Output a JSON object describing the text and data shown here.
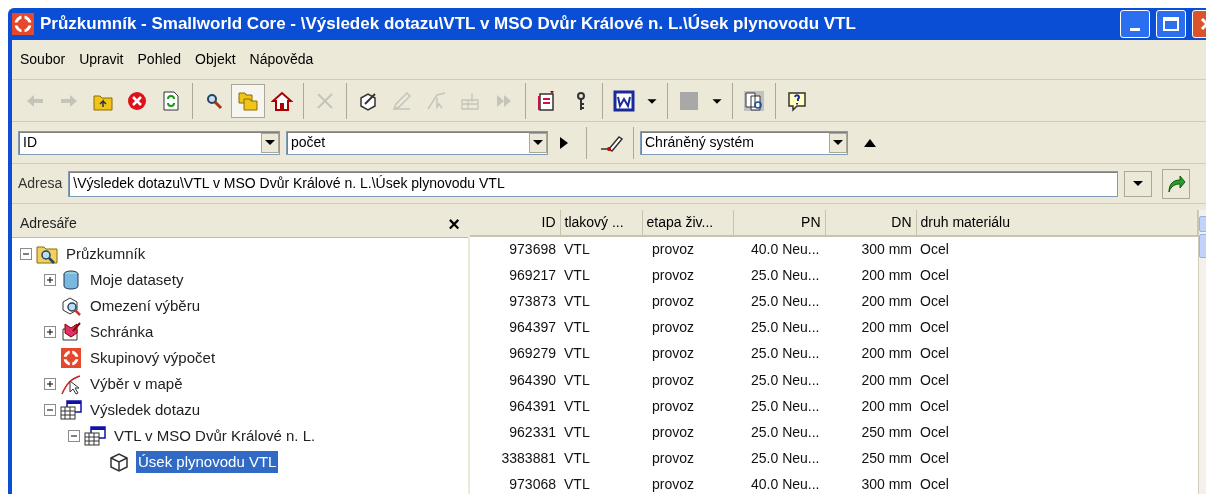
{
  "window": {
    "title": "Průzkumník - Smallworld Core - \\Výsledek dotazu\\VTL v MSO Dvůr Králové n. L.\\Úsek plynovodu VTL"
  },
  "menu": [
    {
      "label": "Soubor"
    },
    {
      "label": "Upravit"
    },
    {
      "label": "Pohled"
    },
    {
      "label": "Objekt"
    },
    {
      "label": "Nápověda"
    }
  ],
  "toolbar": [
    {
      "kind": "back",
      "disabled": true
    },
    {
      "kind": "forward",
      "disabled": true
    },
    {
      "kind": "up-folder",
      "disabled": false
    },
    {
      "kind": "stop",
      "disabled": false
    },
    {
      "kind": "refresh",
      "disabled": false
    },
    {
      "kind": "separator"
    },
    {
      "kind": "search",
      "disabled": false
    },
    {
      "kind": "folders",
      "disabled": false,
      "selected": true
    },
    {
      "kind": "home",
      "disabled": false
    },
    {
      "kind": "separator"
    },
    {
      "kind": "delete",
      "disabled": true
    },
    {
      "kind": "separator"
    },
    {
      "kind": "tool",
      "disabled": false
    },
    {
      "kind": "pencil",
      "disabled": true
    },
    {
      "kind": "pointer",
      "disabled": true
    },
    {
      "kind": "edit",
      "disabled": true
    },
    {
      "kind": "fast-forward",
      "disabled": true
    },
    {
      "kind": "separator"
    },
    {
      "kind": "report",
      "disabled": false
    },
    {
      "kind": "key",
      "disabled": false
    },
    {
      "kind": "separator"
    },
    {
      "kind": "word",
      "disabled": false
    },
    {
      "kind": "dropdown",
      "disabled": false
    },
    {
      "kind": "separator"
    },
    {
      "kind": "pattern",
      "disabled": false
    },
    {
      "kind": "dropdown",
      "disabled": false
    },
    {
      "kind": "separator"
    },
    {
      "kind": "preview",
      "disabled": false
    },
    {
      "kind": "separator"
    },
    {
      "kind": "help",
      "disabled": false
    }
  ],
  "filter": {
    "field": "ID",
    "function": "počet",
    "system": "Chráněný systém"
  },
  "address": {
    "label": "Adresa",
    "value": "\\Výsledek dotazu\\VTL v MSO Dvůr Králové n. L.\\Úsek plynovodu VTL"
  },
  "sidebar": {
    "title": "Adresáře",
    "close": "×",
    "tree": [
      {
        "label": "Průzkumník",
        "kind": "explorer",
        "expanded": true,
        "selected": false,
        "children": [
          {
            "label": "Moje datasety",
            "kind": "database",
            "expanded": false,
            "selected": false
          },
          {
            "label": "Omezení výběru",
            "kind": "constraint",
            "selected": false
          },
          {
            "label": "Schránka",
            "kind": "clipboard",
            "expanded": false,
            "selected": false
          },
          {
            "label": "Skupinový výpočet",
            "kind": "calc",
            "selected": false
          },
          {
            "label": "Výběr v mapě",
            "kind": "map",
            "expanded": false,
            "selected": false
          },
          {
            "label": "Výsledek dotazu",
            "kind": "query",
            "expanded": true,
            "selected": false,
            "children": [
              {
                "label": "VTL v MSO Dvůr Králové n. L.",
                "kind": "query",
                "expanded": true,
                "selected": false,
                "children": [
                  {
                    "label": "Úsek plynovodu VTL",
                    "kind": "object",
                    "selected": true
                  }
                ]
              }
            ]
          }
        ]
      }
    ]
  },
  "table": {
    "columns": [
      "ID",
      "tlakový ...",
      "etapa živ...",
      "PN",
      "DN",
      "druh materiálu"
    ],
    "rows": [
      [
        "973698",
        "VTL",
        "provoz",
        "40.0 Neu...",
        "300 mm",
        "Ocel"
      ],
      [
        "969217",
        "VTL",
        "provoz",
        "25.0 Neu...",
        "200 mm",
        "Ocel"
      ],
      [
        "973873",
        "VTL",
        "provoz",
        "25.0 Neu...",
        "200 mm",
        "Ocel"
      ],
      [
        "964397",
        "VTL",
        "provoz",
        "25.0 Neu...",
        "200 mm",
        "Ocel"
      ],
      [
        "969279",
        "VTL",
        "provoz",
        "25.0 Neu...",
        "200 mm",
        "Ocel"
      ],
      [
        "964390",
        "VTL",
        "provoz",
        "25.0 Neu...",
        "200 mm",
        "Ocel"
      ],
      [
        "964391",
        "VTL",
        "provoz",
        "25.0 Neu...",
        "200 mm",
        "Ocel"
      ],
      [
        "962331",
        "VTL",
        "provoz",
        "25.0 Neu...",
        "250 mm",
        "Ocel"
      ],
      [
        "3383881",
        "VTL",
        "provoz",
        "25.0 Neu...",
        "250 mm",
        "Ocel"
      ],
      [
        "973068",
        "VTL",
        "provoz",
        "40.0 Neu...",
        "300 mm",
        "Ocel"
      ]
    ]
  }
}
